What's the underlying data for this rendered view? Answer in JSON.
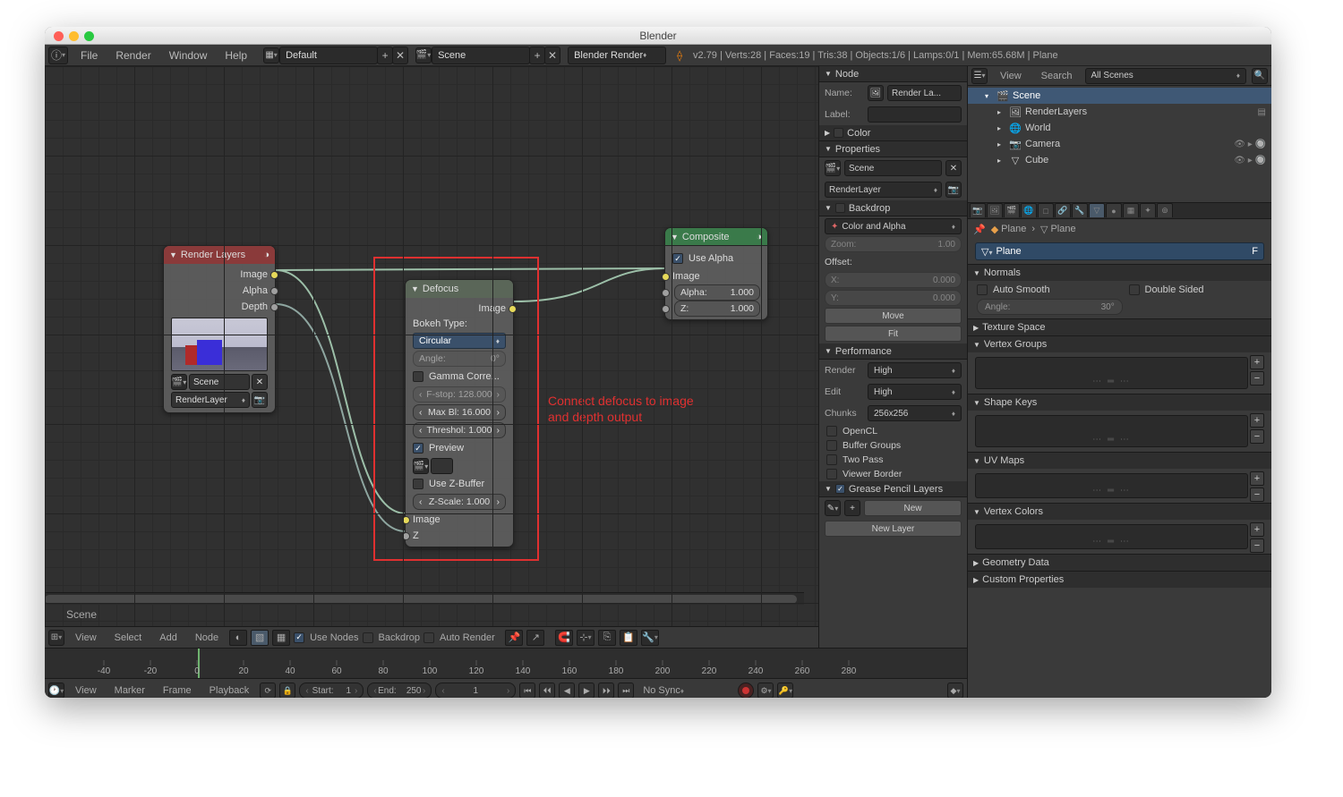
{
  "window": {
    "title": "Blender"
  },
  "menubar": {
    "items": [
      "File",
      "Render",
      "Window",
      "Help"
    ],
    "layout": "Default",
    "scene": "Scene",
    "engine": "Blender Render",
    "status": "v2.79 | Verts:28 | Faces:19 | Tris:38 | Objects:1/6 | Lamps:0/1 | Mem:65.68M | Plane"
  },
  "annotation": {
    "text1": "Connect defocus to image",
    "text2": "and depth output"
  },
  "nodes": {
    "render_layers": {
      "title": "Render Layers",
      "outputs": [
        "Image",
        "Alpha",
        "Depth"
      ],
      "scene": "Scene",
      "layer": "RenderLayer"
    },
    "defocus": {
      "title": "Defocus",
      "out_image": "Image",
      "bokeh_label": "Bokeh Type:",
      "bokeh_type": "Circular",
      "angle_label": "Angle:",
      "angle_value": "0°",
      "gamma": "Gamma Corre...",
      "fstop_label": "F-stop:",
      "fstop_value": "128.000",
      "maxbl_label": "Max Bl:",
      "maxbl_value": "16.000",
      "thresh_label": "Threshol:",
      "thresh_value": "1.000",
      "preview": "Preview",
      "zbuffer": "Use Z-Buffer",
      "zscale_label": "Z-Scale:",
      "zscale_value": "1.000",
      "in_image": "Image",
      "in_z": "Z"
    },
    "composite": {
      "title": "Composite",
      "use_alpha": "Use Alpha",
      "in_image": "Image",
      "alpha_label": "Alpha:",
      "alpha_value": "1.000",
      "z_label": "Z:",
      "z_value": "1.000"
    }
  },
  "node_editor": {
    "scene_label": "Scene",
    "bottombar": {
      "menus": [
        "View",
        "Select",
        "Add",
        "Node"
      ],
      "use_nodes": "Use Nodes",
      "backdrop": "Backdrop",
      "auto_render": "Auto Render"
    }
  },
  "npanel": {
    "node_head": "Node",
    "name_label": "Name:",
    "name_value": "Render La...",
    "label_label": "Label:",
    "color_head": "Color",
    "properties_head": "Properties",
    "scene": "Scene",
    "layer": "RenderLayer",
    "backdrop_head": "Backdrop",
    "backdrop_mode": "Color and Alpha",
    "zoom_label": "Zoom:",
    "zoom_value": "1.00",
    "offset_label": "Offset:",
    "x_label": "X:",
    "x_value": "0.000",
    "y_label": "Y:",
    "y_value": "0.000",
    "move": "Move",
    "fit": "Fit",
    "perf_head": "Performance",
    "render_label": "Render",
    "render_value": "High",
    "edit_label": "Edit",
    "edit_value": "High",
    "chunks_label": "Chunks",
    "chunks_value": "256x256",
    "opencl": "OpenCL",
    "buffer_groups": "Buffer Groups",
    "two_pass": "Two Pass",
    "viewer_border": "Viewer Border",
    "gp_head": "Grease Pencil Layers",
    "new_btn": "New",
    "new_layer": "New Layer"
  },
  "outliner": {
    "menus": [
      "View",
      "Search"
    ],
    "filter": "All Scenes",
    "items": [
      {
        "label": "Scene",
        "depth": 0,
        "sel": true,
        "ico": "🎬"
      },
      {
        "label": "RenderLayers",
        "depth": 1,
        "ico": "🖼"
      },
      {
        "label": "World",
        "depth": 1,
        "ico": "🌐"
      },
      {
        "label": "Camera",
        "depth": 1,
        "ico": "📷"
      },
      {
        "label": "Cube",
        "depth": 1,
        "ico": "▽"
      }
    ]
  },
  "props": {
    "crumb1": "Plane",
    "crumb2": "Plane",
    "datablock": "Plane",
    "datablock_f": "F",
    "normals_head": "Normals",
    "auto_smooth": "Auto Smooth",
    "double_sided": "Double Sided",
    "angle_label": "Angle:",
    "angle_value": "30°",
    "texture_space_head": "Texture Space",
    "vertex_groups_head": "Vertex Groups",
    "shape_keys_head": "Shape Keys",
    "uv_maps_head": "UV Maps",
    "vertex_colors_head": "Vertex Colors",
    "geometry_data_head": "Geometry Data",
    "custom_props_head": "Custom Properties"
  },
  "timeline": {
    "ticks": [
      -40,
      -20,
      0,
      20,
      40,
      60,
      80,
      100,
      120,
      140,
      160,
      180,
      200,
      220,
      240,
      260,
      280
    ],
    "menus": [
      "View",
      "Marker",
      "Frame",
      "Playback"
    ],
    "start_label": "Start:",
    "start_value": "1",
    "end_label": "End:",
    "end_value": "250",
    "current": "1",
    "sync": "No Sync"
  }
}
